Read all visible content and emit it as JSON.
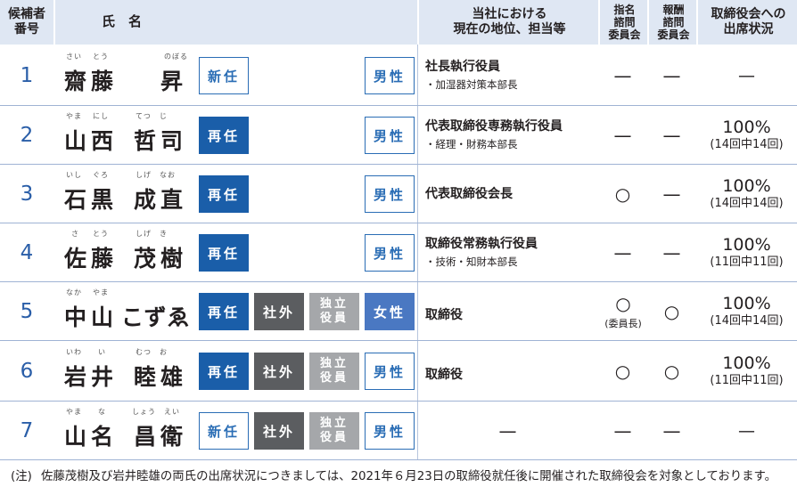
{
  "header": {
    "col_no_1": "候補者",
    "col_no_2": "番号",
    "col_name": "氏　名",
    "col_position_1": "当社における",
    "col_position_2": "現在の地位、担当等",
    "col_nom_1": "指名",
    "col_nom_2": "諮問",
    "col_nom_3": "委員会",
    "col_rem_1": "報酬",
    "col_rem_2": "諮問",
    "col_rem_3": "委員会",
    "col_att_1": "取締役会への",
    "col_att_2": "出席状況"
  },
  "rows": [
    {
      "no": "1",
      "surname": "齋藤",
      "given": "昇",
      "ruby_s1": "さい",
      "ruby_s2": "とう",
      "ruby_g": "のぼる",
      "status": "新任",
      "gender": "男性",
      "pos_main": "社長執行役員",
      "pos_sub": "・加湿器対策本部長",
      "nom": "—",
      "rem": "—",
      "att_main": "—",
      "att_sub": ""
    },
    {
      "no": "2",
      "surname": "山西",
      "given": "哲司",
      "ruby_s1": "やま",
      "ruby_s2": "にし",
      "ruby_g": "てつ　じ",
      "status": "再任",
      "gender": "男性",
      "pos_main": "代表取締役専務執行役員",
      "pos_sub": "・経理・財務本部長",
      "nom": "—",
      "rem": "—",
      "att_main": "100%",
      "att_sub": "(14回中14回)"
    },
    {
      "no": "3",
      "surname": "石黒",
      "given": "成直",
      "ruby_s1": "いし",
      "ruby_s2": "ぐろ",
      "ruby_g": "しげ　なお",
      "status": "再任",
      "gender": "男性",
      "pos_main": "代表取締役会長",
      "pos_sub": "",
      "nom": "○",
      "rem": "—",
      "att_main": "100%",
      "att_sub": "(14回中14回)"
    },
    {
      "no": "4",
      "surname": "佐藤",
      "given": "茂樹",
      "ruby_s1": "さ",
      "ruby_s2": "とう",
      "ruby_g": "しげ　き",
      "status": "再任",
      "gender": "男性",
      "pos_main": "取締役常務執行役員",
      "pos_sub": "・技術・知財本部長",
      "nom": "—",
      "rem": "—",
      "att_main": "100%",
      "att_sub": "(11回中11回)"
    },
    {
      "no": "5",
      "surname": "中山",
      "given": "こずゑ",
      "ruby_s1": "なか",
      "ruby_s2": "やま",
      "ruby_g": "",
      "status": "再任",
      "outside": "社外",
      "ind1": "独立",
      "ind2": "役員",
      "gender": "女性",
      "pos_main": "取締役",
      "pos_sub": "",
      "nom": "○",
      "nom_sub": "(委員長)",
      "rem": "○",
      "att_main": "100%",
      "att_sub": "(14回中14回)"
    },
    {
      "no": "6",
      "surname": "岩井",
      "given": "睦雄",
      "ruby_s1": "いわ",
      "ruby_s2": "い",
      "ruby_g": "むつ　お",
      "status": "再任",
      "outside": "社外",
      "ind1": "独立",
      "ind2": "役員",
      "gender": "男性",
      "pos_main": "取締役",
      "pos_sub": "",
      "nom": "○",
      "rem": "○",
      "att_main": "100%",
      "att_sub": "(11回中11回)"
    },
    {
      "no": "7",
      "surname": "山名",
      "given": "昌衛",
      "ruby_s1": "やま",
      "ruby_s2": "な",
      "ruby_g": "しょう　えい",
      "status": "新任",
      "outside": "社外",
      "ind1": "独立",
      "ind2": "役員",
      "gender": "男性",
      "pos_main": "—",
      "pos_sub": "",
      "nom": "—",
      "rem": "—",
      "att_main": "—",
      "att_sub": ""
    }
  ],
  "note": {
    "label": "(注)",
    "text": "佐藤茂樹及び岩井睦雄の両氏の出席状況につきましては、2021年６月23日の取締役就任後に開催された取締役会を対象としております。"
  },
  "colors": {
    "header_bg": "#dfe7f3",
    "blue": "#1a5ea9",
    "female": "#4a78c2",
    "outside": "#5b5d60",
    "independent": "#a5a7aa"
  }
}
